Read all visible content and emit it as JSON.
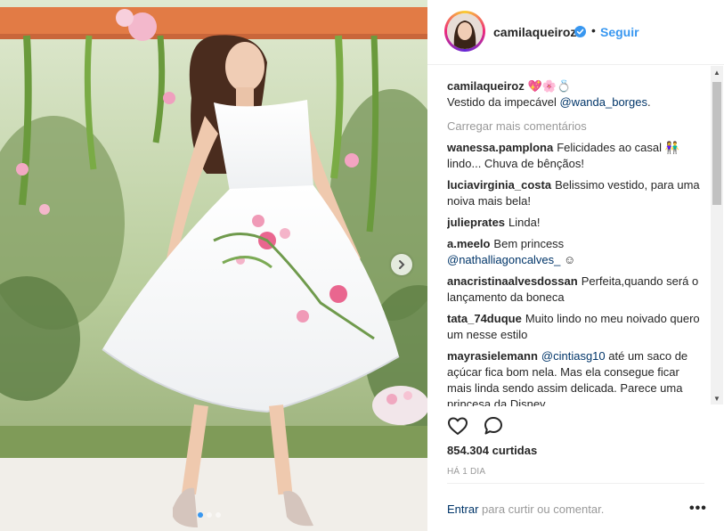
{
  "post": {
    "username": "camilaqueiroz",
    "separator": "•",
    "follow_label": "Seguir",
    "caption_user": "camilaqueiroz",
    "caption_text": "💖🌸💍",
    "caption_line2_prefix": "Vestido da impecável",
    "caption_mention": "@wanda_borges",
    "caption_line2_suffix": ".",
    "load_more_label": "Carregar mais comentários",
    "likes": "854.304 curtidas",
    "time": "HÁ 1 DIA",
    "login_link": "Entrar",
    "login_text": "para curtir ou comentar.",
    "more_label": "•••"
  },
  "comments": [
    {
      "user": "wanessa.pamplona",
      "text": "Felicidades ao casal 👫 lindo... Chuva de bênçãos!"
    },
    {
      "user": "luciavirginia_costa",
      "text": "Belissimo vestido, para uma noiva mais bela!"
    },
    {
      "user": "julieprates",
      "text": "Linda!"
    },
    {
      "user": "a.meelo",
      "text": "Bem princess",
      "mention": "@nathalliagoncalves_",
      "after": " ☺"
    },
    {
      "user": "anacristinaalvesdossan",
      "text": "Perfeita,quando será o lançamento da boneca"
    },
    {
      "user": "tata_74duque",
      "text": "Muito lindo no meu noivado quero um nesse estilo"
    },
    {
      "user": "mayrasielemann",
      "mention": "@cintiasg10",
      "after": " até um saco de açúcar fica bom nela. Mas ela consegue ficar mais linda sendo assim delicada. Parece uma princesa da Disney"
    }
  ],
  "colors": {
    "link": "#3897f0",
    "mention": "#003569",
    "text": "#262626",
    "muted": "#999999"
  }
}
